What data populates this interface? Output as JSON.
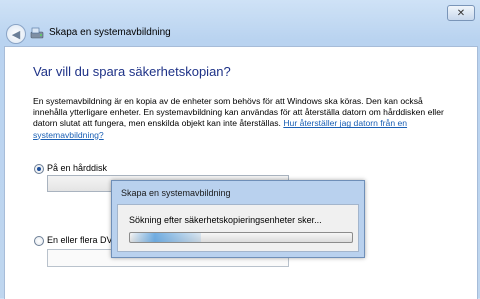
{
  "window": {
    "title": "Skapa en systemavbildning",
    "close_glyph": "✕"
  },
  "page": {
    "heading": "Var vill du spara säkerhetskopian?",
    "description": "En systemavbildning är en kopia av de enheter som behövs för att Windows ska köras. Den kan också innehålla ytterligare enheter. En systemavbildning kan användas för att återställa datorn om hårddisken eller datorn slutat att fungera, men enskilda objekt kan inte återställas.",
    "help_link": "Hur återställer jag datorn från en systemavbildning?"
  },
  "options": [
    {
      "label": "På en hårddisk",
      "selected": true
    },
    {
      "label": "En eller flera DVD",
      "selected": false
    }
  ],
  "progress_dialog": {
    "title": "Skapa en systemavbildning",
    "message": "Sökning efter säkerhetskopieringsenheter sker...",
    "progress_fraction": 0.32
  },
  "icons": {
    "back": "back-arrow-icon",
    "app": "backup-drive-icon"
  },
  "colors": {
    "heading": "#1e3287",
    "link": "#1a5fb4",
    "frame": "#bfd6ef"
  }
}
